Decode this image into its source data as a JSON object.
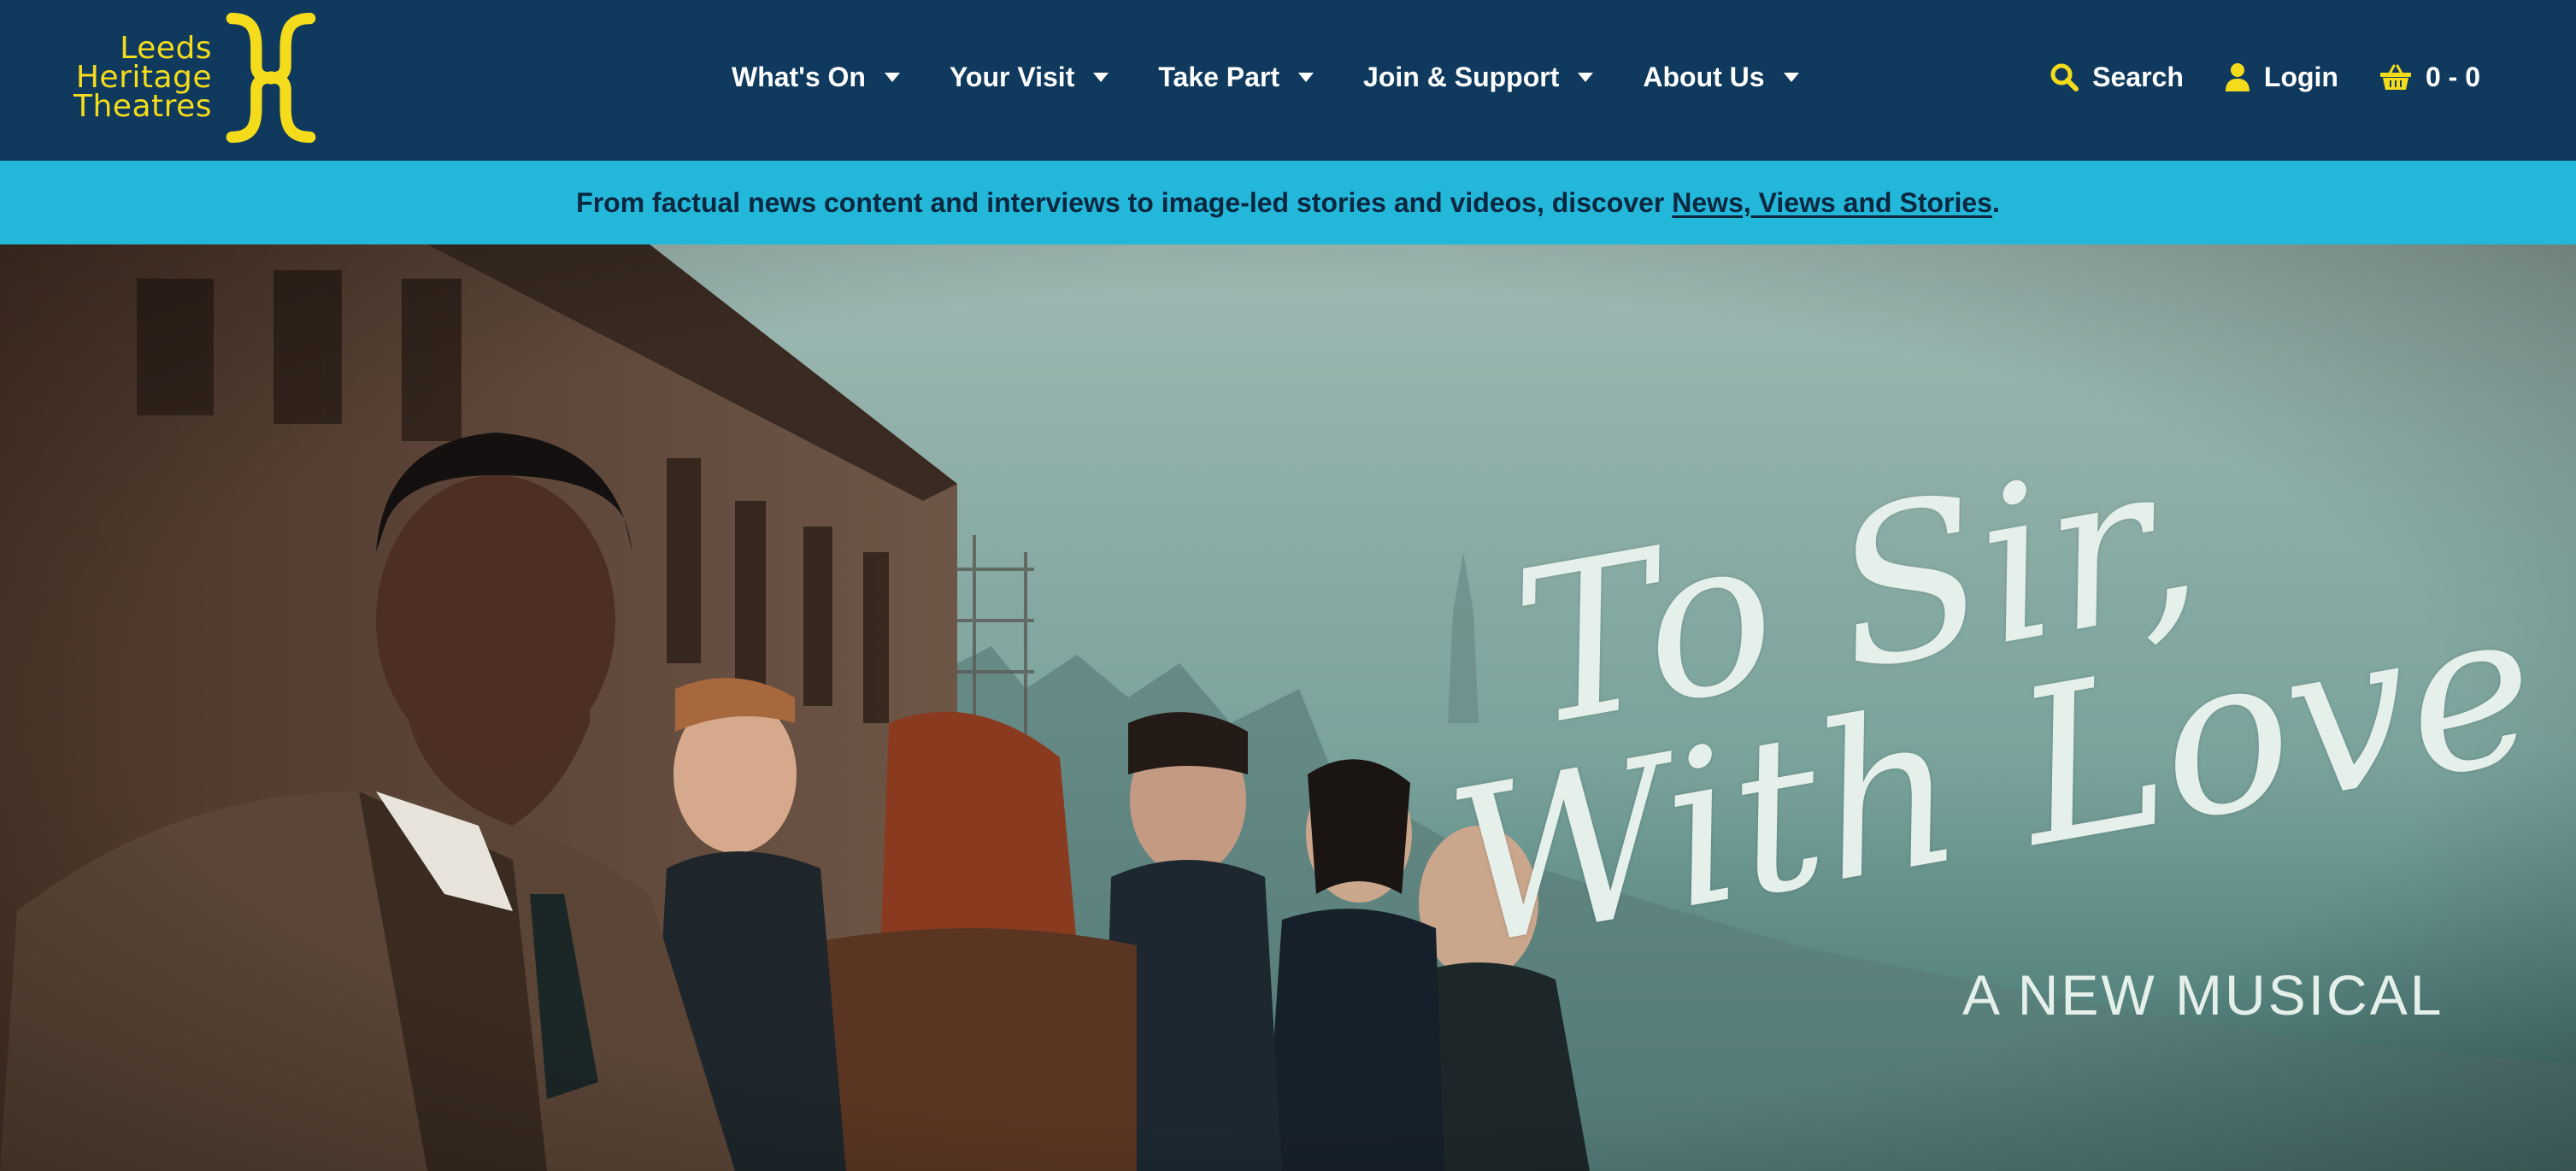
{
  "brand": {
    "logo_line1": "Leeds",
    "logo_line2": "Heritage",
    "logo_line3": "Theatres",
    "accent_color": "#f4dc1c",
    "header_color": "#0f3a5e"
  },
  "nav": {
    "items": [
      {
        "label": "What's On"
      },
      {
        "label": "Your Visit"
      },
      {
        "label": "Take Part"
      },
      {
        "label": "Join & Support"
      },
      {
        "label": "About Us"
      }
    ]
  },
  "utility": {
    "search_label": "Search",
    "login_label": "Login",
    "basket_label": "0 - 0",
    "search_icon": "search-icon",
    "login_icon": "user-icon",
    "basket_icon": "basket-icon"
  },
  "banner": {
    "text": "From factual news content and interviews to image-led stories and videos, discover ",
    "link_text": "News, Views and Stories",
    "suffix": ".",
    "color": "#23b8da"
  },
  "hero": {
    "title_line1": "To Sir,",
    "title_line2": "With Love",
    "subtitle": "A NEW MUSICAL"
  }
}
